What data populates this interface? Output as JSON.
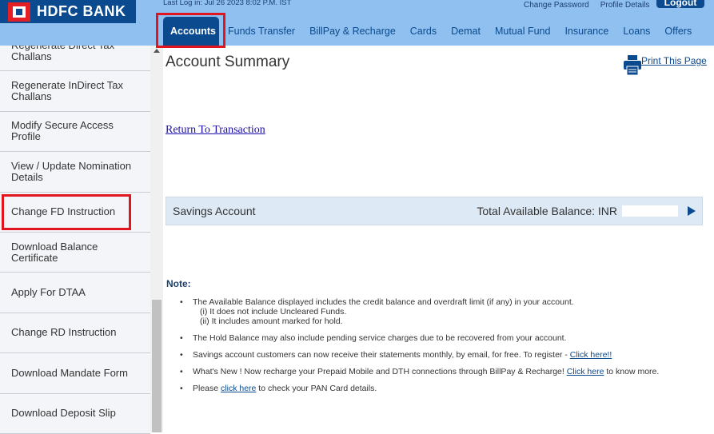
{
  "header": {
    "logo_text": "HDFC BANK",
    "last_login": "Last Log in: Jul 26 2023 8:02 P.M. IST",
    "change_password": "Change Password",
    "profile_details": "Profile Details",
    "logout": "Logout",
    "tabs": [
      "Accounts",
      "Funds Transfer",
      "BillPay & Recharge",
      "Cards",
      "Demat",
      "Mutual Fund",
      "Insurance",
      "Loans",
      "Offers"
    ]
  },
  "sidebar": {
    "items": [
      "Regenerate Direct Tax Challans",
      "Regenerate InDirect Tax Challans",
      "Modify Secure Access Profile",
      "View / Update Nomination Details",
      "Change FD Instruction",
      "Download Balance Certificate",
      "Apply For DTAA",
      "Change RD Instruction",
      "Download Mandate Form",
      "Download Deposit Slip"
    ]
  },
  "main": {
    "title": "Account Summary",
    "print": "Print This Page",
    "return": "Return To Transaction",
    "account": {
      "type": "Savings Account",
      "balance_label": "Total Available Balance: INR"
    },
    "note_title": "Note:",
    "notes": {
      "n1": "The Available Balance displayed includes the credit balance and overdraft limit (if any) in your account.",
      "n1a": "(i) It does not include Uncleared Funds.",
      "n1b": "(ii) It includes amount marked for hold.",
      "n2": "The Hold Balance may also include pending service charges due to be recovered from your account.",
      "n3": "Savings account customers can now receive their statements monthly, by email, for free. To register - ",
      "n3_link": "Click here!!",
      "n4": "What's New ! Now recharge your Prepaid Mobile and DTH connections through BillPay & Recharge! ",
      "n4_link": "Click here",
      "n4_end": " to know more.",
      "n5": "Please ",
      "n5_link": "click here",
      "n5_end": " to check your PAN Card details."
    }
  }
}
